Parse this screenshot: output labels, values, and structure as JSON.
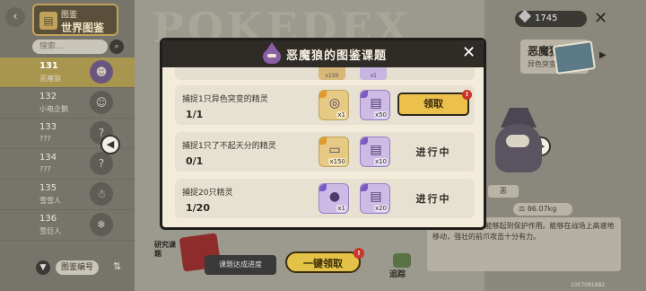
{
  "background": {
    "header": {
      "logo_small": "图鉴",
      "logo_big": "世界图鉴",
      "dex_word": "POKEDEX"
    },
    "search": {
      "placeholder": "搜索..."
    },
    "dex_list": [
      {
        "number": "131",
        "name": "恶魔狼",
        "active": true
      },
      {
        "number": "132",
        "name": "小电企鹅",
        "active": false
      },
      {
        "number": "133",
        "name": "???",
        "active": false
      },
      {
        "number": "134",
        "name": "???",
        "active": false
      },
      {
        "number": "135",
        "name": "雪雪人",
        "active": false
      },
      {
        "number": "136",
        "name": "雪巨人",
        "active": false
      }
    ],
    "list_footer": {
      "sort_label": "图鉴编号"
    },
    "currency": {
      "value": "1745"
    },
    "side_info": {
      "name": "恶魔狼",
      "tag": "异色突变",
      "small_tag": "恶",
      "weight": "86.07kg"
    },
    "description": "…… 阻挡，似乎能够起到保护作用。能够在战场上高速地移动，强壮的前爪攻击十分有力。",
    "bottom": {
      "research_label": "研究课题",
      "progress_label": "课题达成进度",
      "claim_all": "一键领取",
      "trace_label": "追踪",
      "build_id": "1007081882"
    }
  },
  "modal": {
    "title": "恶魔狼的图鉴课题",
    "stub_rewards": [
      {
        "qty": "x150"
      },
      {
        "qty": "x5"
      }
    ],
    "tasks": [
      {
        "desc": "捕捉1只异色突变的精灵",
        "progress": "1/1",
        "rewards": [
          {
            "type": "gold",
            "icon": "compass-icon",
            "glyph": "◎",
            "qty": "x1"
          },
          {
            "type": "purple",
            "icon": "ticket-icon",
            "glyph": "▤",
            "qty": "x50"
          }
        ],
        "action": "领取",
        "action_type": "claim"
      },
      {
        "desc": "捕捉1只了不起天分的精灵",
        "progress": "0/1",
        "rewards": [
          {
            "type": "gold",
            "icon": "card-icon",
            "glyph": "▭",
            "qty": "x150"
          },
          {
            "type": "purple",
            "icon": "ticket-icon",
            "glyph": "▤",
            "qty": "x10"
          }
        ],
        "action": "进行中",
        "action_type": "status"
      },
      {
        "desc": "捕捉20只精灵",
        "progress": "1/20",
        "rewards": [
          {
            "type": "purple",
            "icon": "pouch-icon",
            "glyph": "●",
            "qty": "x1"
          },
          {
            "type": "purple",
            "icon": "ticket-icon",
            "glyph": "▤",
            "qty": "x20"
          }
        ],
        "action": "进行中",
        "action_type": "status"
      }
    ]
  }
}
